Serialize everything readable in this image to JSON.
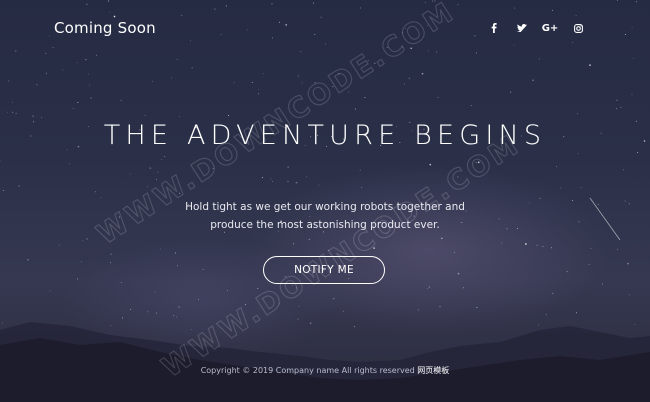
{
  "header": {
    "brand": "Coming Soon",
    "social": [
      {
        "icon": "facebook-icon",
        "label": "f"
      },
      {
        "icon": "twitter-icon",
        "label": ""
      },
      {
        "icon": "google-plus-icon",
        "label": "G+"
      },
      {
        "icon": "instagram-icon",
        "label": ""
      }
    ]
  },
  "hero": {
    "headline": "THE ADVENTURE BEGINS",
    "tagline_line1": "Hold tight as we get our working robots together and",
    "tagline_line2": "produce the most astonishing product ever.",
    "notify_label": "NOTIFY ME"
  },
  "footer": {
    "copyright": "Copyright © 2019 Company name All rights reserved ",
    "link": "网页模板"
  },
  "watermark": {
    "text": "WWW.DOWNCODE.COM"
  },
  "colors": {
    "sky_top": "#262b44",
    "sky_bottom": "#2a2b3d",
    "text": "#ffffff",
    "footer_text": "#b9bccb"
  }
}
